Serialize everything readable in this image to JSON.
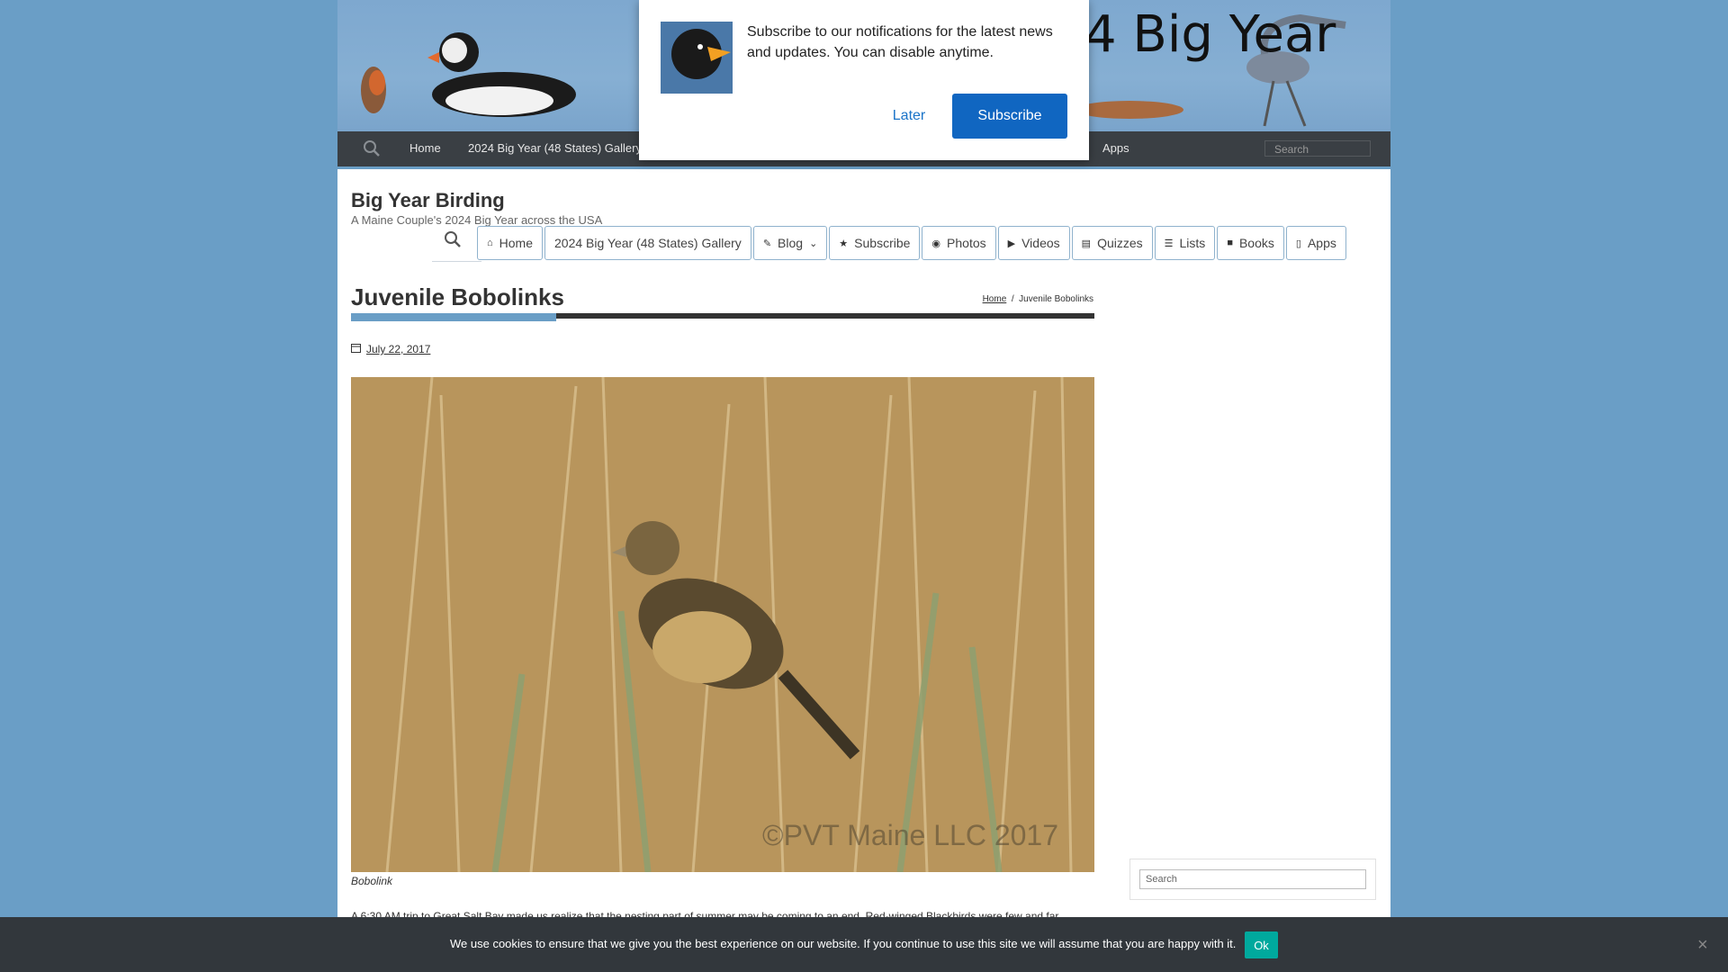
{
  "banner": {
    "title_fragment": "4 Big Year"
  },
  "topnav": {
    "search_placeholder": "Search",
    "items": [
      "Home",
      "2024 Big Year (48 States) Gallery",
      "Apps"
    ]
  },
  "site": {
    "title": "Big Year Birding",
    "tagline": "A Maine Couple's 2024 Big Year across the USA"
  },
  "menu": {
    "items": [
      {
        "label": "Home",
        "icon": "home-icon"
      },
      {
        "label": "2024 Big Year (48 States) Gallery",
        "icon": ""
      },
      {
        "label": "Blog",
        "icon": "book-edit-icon"
      },
      {
        "label": "Subscribe",
        "icon": "star-icon"
      },
      {
        "label": "Photos",
        "icon": "camera-icon"
      },
      {
        "label": "Videos",
        "icon": "video-icon"
      },
      {
        "label": "Quizzes",
        "icon": "quiz-icon"
      },
      {
        "label": "Lists",
        "icon": "list-icon"
      },
      {
        "label": "Books",
        "icon": "books-icon"
      },
      {
        "label": "Apps",
        "icon": "phone-icon"
      }
    ]
  },
  "post": {
    "title": "Juvenile Bobolinks",
    "breadcrumb_home": "Home",
    "breadcrumb_sep": "/",
    "breadcrumb_current": "Juvenile Bobolinks",
    "date": "July 22, 2017",
    "image_watermark": "©PVT Maine LLC 2017",
    "caption": "Bobolink",
    "body_start": "A 6:30 AM trip to Great Salt Bay made us realize that the nesting part of summer may be coming to an end. Red-winged Blackbirds were few and far"
  },
  "sidebar": {
    "search_placeholder": "Search"
  },
  "notification": {
    "message": "Subscribe to our notifications for the latest news and updates. You can disable anytime.",
    "later_label": "Later",
    "subscribe_label": "Subscribe"
  },
  "cookie": {
    "message": "We use cookies to ensure that we give you the best experience on our website. If you continue to use this site we will assume that you are happy with it.",
    "ok_label": "Ok",
    "close_label": "×"
  },
  "colors": {
    "background": "#6a9ec6",
    "nav": "#3a3f44",
    "accent": "#6a9ec6",
    "subscribe_button": "#1066c1",
    "cookie_ok": "#00a99d"
  }
}
